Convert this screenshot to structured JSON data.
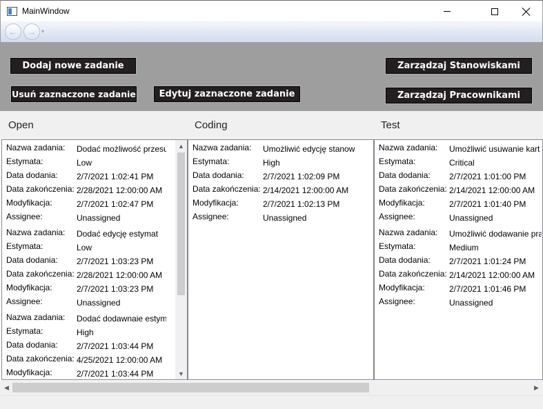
{
  "window": {
    "title": "MainWindow",
    "icon": "app-window-icon",
    "controls": [
      "minimize-icon",
      "maximize-icon",
      "close-icon"
    ]
  },
  "nav": {
    "back_glyph": "←",
    "forward_glyph": "→",
    "dropdown_glyph": "▾"
  },
  "toolbar": {
    "add_task": "Dodaj nowe zadanie",
    "delete_selected": "Usuń zaznaczone zadanie",
    "edit_selected": "Edytuj zaznaczone zadanie",
    "manage_positions": "Zarządzaj Stanowiskami",
    "manage_employees": "Zarządzaj Pracownikami"
  },
  "labels": {
    "name": "Nazwa zadania:",
    "estimate": "Estymata:",
    "date_added": "Data dodania:",
    "date_completed": "Data zakończenia:",
    "modification": "Modyfikacja:",
    "assignee": "Assignee:"
  },
  "columns": [
    {
      "title": "Open",
      "tasks": [
        {
          "name": "Dodać możliwość przesu",
          "estimate": "Low",
          "date_added": "2/7/2021 1:02:41 PM",
          "date_completed": "2/28/2021 12:00:00 AM",
          "modification": "2/7/2021 1:02:47 PM",
          "assignee": "Unassigned"
        },
        {
          "name": "Dodać edycję estymat",
          "estimate": "Low",
          "date_added": "2/7/2021 1:03:23 PM",
          "date_completed": "2/28/2021 12:00:00 AM",
          "modification": "2/7/2021 1:03:23 PM",
          "assignee": "Unassigned"
        },
        {
          "name": "Dodać dodawnaie estym",
          "estimate": "High",
          "date_added": "2/7/2021 1:03:44 PM",
          "date_completed": "4/25/2021 12:00:00 AM",
          "modification": "2/7/2021 1:03:44 PM",
          "assignee": ""
        }
      ]
    },
    {
      "title": "Coding",
      "tasks": [
        {
          "name": "Umożliwić edycję stanow",
          "estimate": "High",
          "date_added": "2/7/2021 1:02:09 PM",
          "date_completed": "2/14/2021 12:00:00 AM",
          "modification": "2/7/2021 1:02:13 PM",
          "assignee": "Unassigned"
        }
      ]
    },
    {
      "title": "Test",
      "tasks": [
        {
          "name": "Umożliwić usuwanie kart",
          "estimate": "Critical",
          "date_added": "2/7/2021 1:01:00 PM",
          "date_completed": "2/14/2021 12:00:00 AM",
          "modification": "2/7/2021 1:01:40 PM",
          "assignee": "Unassigned"
        },
        {
          "name": "Umożliwić dodawanie pra",
          "estimate": "Medium",
          "date_added": "2/7/2021 1:01:24 PM",
          "date_completed": "2/14/2021 12:00:00 AM",
          "modification": "2/7/2021 1:01:46 PM",
          "assignee": "Unassigned"
        }
      ]
    }
  ],
  "scrollbars": {
    "up_glyph": "▲",
    "down_glyph": "▼",
    "left_glyph": "◀",
    "right_glyph": "▶"
  },
  "colors": {
    "toolbar_bg": "#9e9e9e",
    "button_bg": "#231f20",
    "button_text": "#ffffff"
  }
}
